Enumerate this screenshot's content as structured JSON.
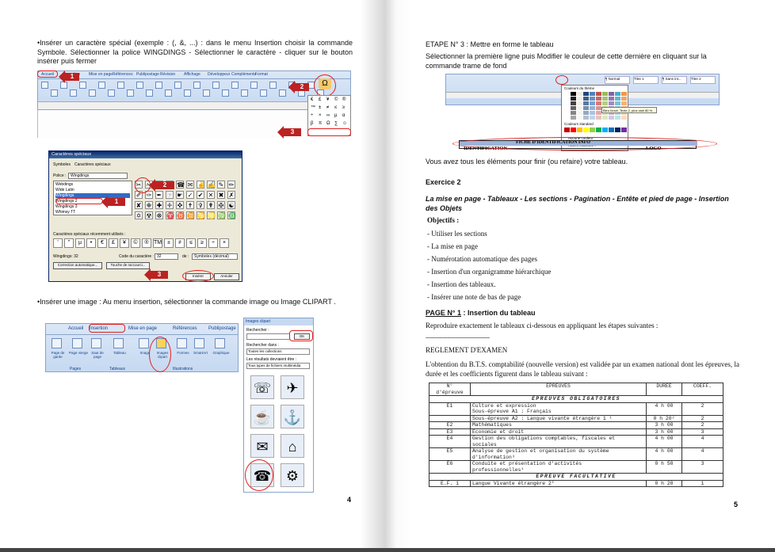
{
  "left_page": {
    "para1": "•Insérer un caractère spécial (exemple : (, &, ...) : dans le menu Insertion choisir la commande Symbole. Sélectionner la police WINGDINGS - Sélectionner le caractère - cliquer sur le bouton insérer puis fermer",
    "ribbon_tabs": [
      "Accueil",
      "Insertion",
      "Mise en page",
      "Références",
      "Publipostage",
      "Révision",
      "Affichage",
      "Développeur",
      "Compléments",
      "Format"
    ],
    "callout_1": "1",
    "callout_2": "2",
    "callout_3": "3",
    "dialog": {
      "title": "Caractères spéciaux",
      "tabs": [
        "Symboles",
        "Caractères spéciaux"
      ],
      "police_label": "Police :",
      "police_value": "Wingdings",
      "font_list": [
        "Webdings",
        "Wide Latin",
        "Wingdings",
        "Wingdings 2",
        "Wingdings 3",
        "Whimsy TT"
      ],
      "recent_label": "Caractères spéciaux récemment utilisés :",
      "recent_symbols": [
        "'",
        "\"",
        "µ",
        "•",
        "€",
        "£",
        "¥",
        "©",
        "®",
        "TM",
        "±",
        "≠",
        "≤",
        "≥",
        "÷",
        "×"
      ],
      "code_label": "Wingdings: 32",
      "code_char_label": "Code du caractère :",
      "code_char_value": "32",
      "de_label": "de :",
      "de_value": "Symboles (décimal)",
      "autocorrect_btn": "Correction automatique...",
      "shortcut_btn": "Touche de raccourci...",
      "insert_btn": "Insérer",
      "cancel_btn": "Annuler",
      "grid": [
        "✂",
        "✁",
        "✇",
        "✆",
        "☎",
        "✉",
        "✌",
        "✍",
        "✎",
        "✏",
        "✐",
        "✑",
        "✒",
        "☞",
        "☛",
        "✓",
        "✔",
        "✕",
        "✖",
        "✗",
        "✘",
        "✙",
        "✚",
        "✛",
        "✜",
        "✝",
        "✞",
        "✟",
        "✠",
        "☯",
        "✡",
        "☢",
        "☸",
        "♈",
        "♉",
        "♊",
        "♋",
        "♌",
        "♍",
        "♎"
      ]
    },
    "para2": "•Insérer une image : Au menu insertion, sélectionner la commande image ou Image CLIPART .",
    "ribbon2": {
      "tabs": [
        "Accueil",
        "Insertion",
        "Mise en page",
        "Références",
        "Publipostage"
      ],
      "groups": [
        "Pages",
        "Tableaux",
        "Illustrations"
      ],
      "buttons": [
        "Page de garde",
        "Page vierge",
        "Saut de page",
        "Tableau",
        "Image",
        "Images clipart",
        "Formes",
        "SmartArt",
        "Graphique"
      ]
    },
    "clipart_panel": {
      "title": "Images clipart",
      "search_label": "Rechercher :",
      "ok": "OK",
      "in_label": "Rechercher dans :",
      "in_value": "Toutes les collections",
      "result_label": "Les résultats devraient être :",
      "result_value": "Tous types de fichiers multimédia"
    },
    "page_number": "4"
  },
  "right_page": {
    "etape3_title": "ETAPE N° 3 : Mettre en forme le tableau",
    "etape3_text": "Sélectionner la première ligne puis Modifier le couleur de cette dernière en cliquant sur la commande trame de fond",
    "color_panel": {
      "theme_label": "Couleurs du thème",
      "std_label": "Couleurs standard",
      "none_label": "Aucune couleur",
      "more_label": "Autres couleurs...",
      "tooltip": "Bleu foncé, Texte 2, plus clair 80 %",
      "styles": [
        "¶ Normal",
        "Titre 1",
        "¶ Sans int...",
        "Titre 2"
      ]
    },
    "fiche_label": "FICHE D'IDENTIFICATION INFO",
    "ident_label": "IDENTIFICATION",
    "logo_label": "LOGO",
    "after_text": "Vous avez tous les éléments pour finir (ou refaire) votre tableau.",
    "exercice": "Exercice 2",
    "subtitle": "La mise en page - Tableaux - Les sections - Pagination - Entête et pied de page - Insertion des Objets",
    "objectifs_label": "Objectifs :",
    "objectifs": [
      "- Utiliser les sections",
      "- La mise en page",
      "- Numérotation automatique des pages",
      "- Insertion d'un organigramme hiérarchique",
      "- Insertion des tableaux.",
      "- Insérer une note de bas de page"
    ],
    "page1_title": "PAGE N° 1",
    "page1_rest": " : Insertion du tableau",
    "page1_text": "Reproduire exactement le tableaux ci-dessous en appliquant les étapes suivantes :",
    "dashes": "--------------------------------------------",
    "reglement": "REGLEMENT D'EXAMEN",
    "reglement_text": "L'obtention du B.T.S. comptabilité (nouvelle version) est validée par un examen national dont les épreuves, la durée et les coefficients figurent dans le tableau suivant :",
    "table": {
      "head": [
        "N°\nd'épreuve",
        "EPREUVES",
        "DUREE",
        "COEFF."
      ],
      "section1": "EPREUVES OBLIGATOIRES",
      "rows": [
        {
          "n": "E1",
          "lines": [
            "Culture et expression",
            "Sous-épreuve A1 : Français"
          ],
          "d": "4 h 00",
          "c": "2"
        },
        {
          "n": "",
          "lines": [
            "Sous-épreuve A2 : Langue vivante étrangère 1 ¹"
          ],
          "d": "0 h 20²",
          "c": "2"
        },
        {
          "n": "E2",
          "lines": [
            "Mathématiques"
          ],
          "d": "3 h 00",
          "c": "2"
        },
        {
          "n": "E3",
          "lines": [
            "Economie et droit"
          ],
          "d": "3 h 00",
          "c": "3"
        },
        {
          "n": "E4",
          "lines": [
            "Gestion des obligations comptables, fiscales et",
            "sociales"
          ],
          "d": "4 h 00",
          "c": "4"
        },
        {
          "n": "E5",
          "lines": [
            "Analyse de gestion et organisation du système",
            "d'information³"
          ],
          "d": "4 h 00",
          "c": "4"
        },
        {
          "n": "E6",
          "lines": [
            "Conduite et présentation d'activités",
            "professionnelles⁴"
          ],
          "d": "0 h 50",
          "c": "3"
        }
      ],
      "section2": "EPREUVE FACULTATIVE",
      "last": {
        "n": "E.F. 1",
        "lines": [
          "Langue Vivante étrangère 2⁵"
        ],
        "d": "0 h 20",
        "c": "1"
      }
    },
    "page_number": "5"
  }
}
